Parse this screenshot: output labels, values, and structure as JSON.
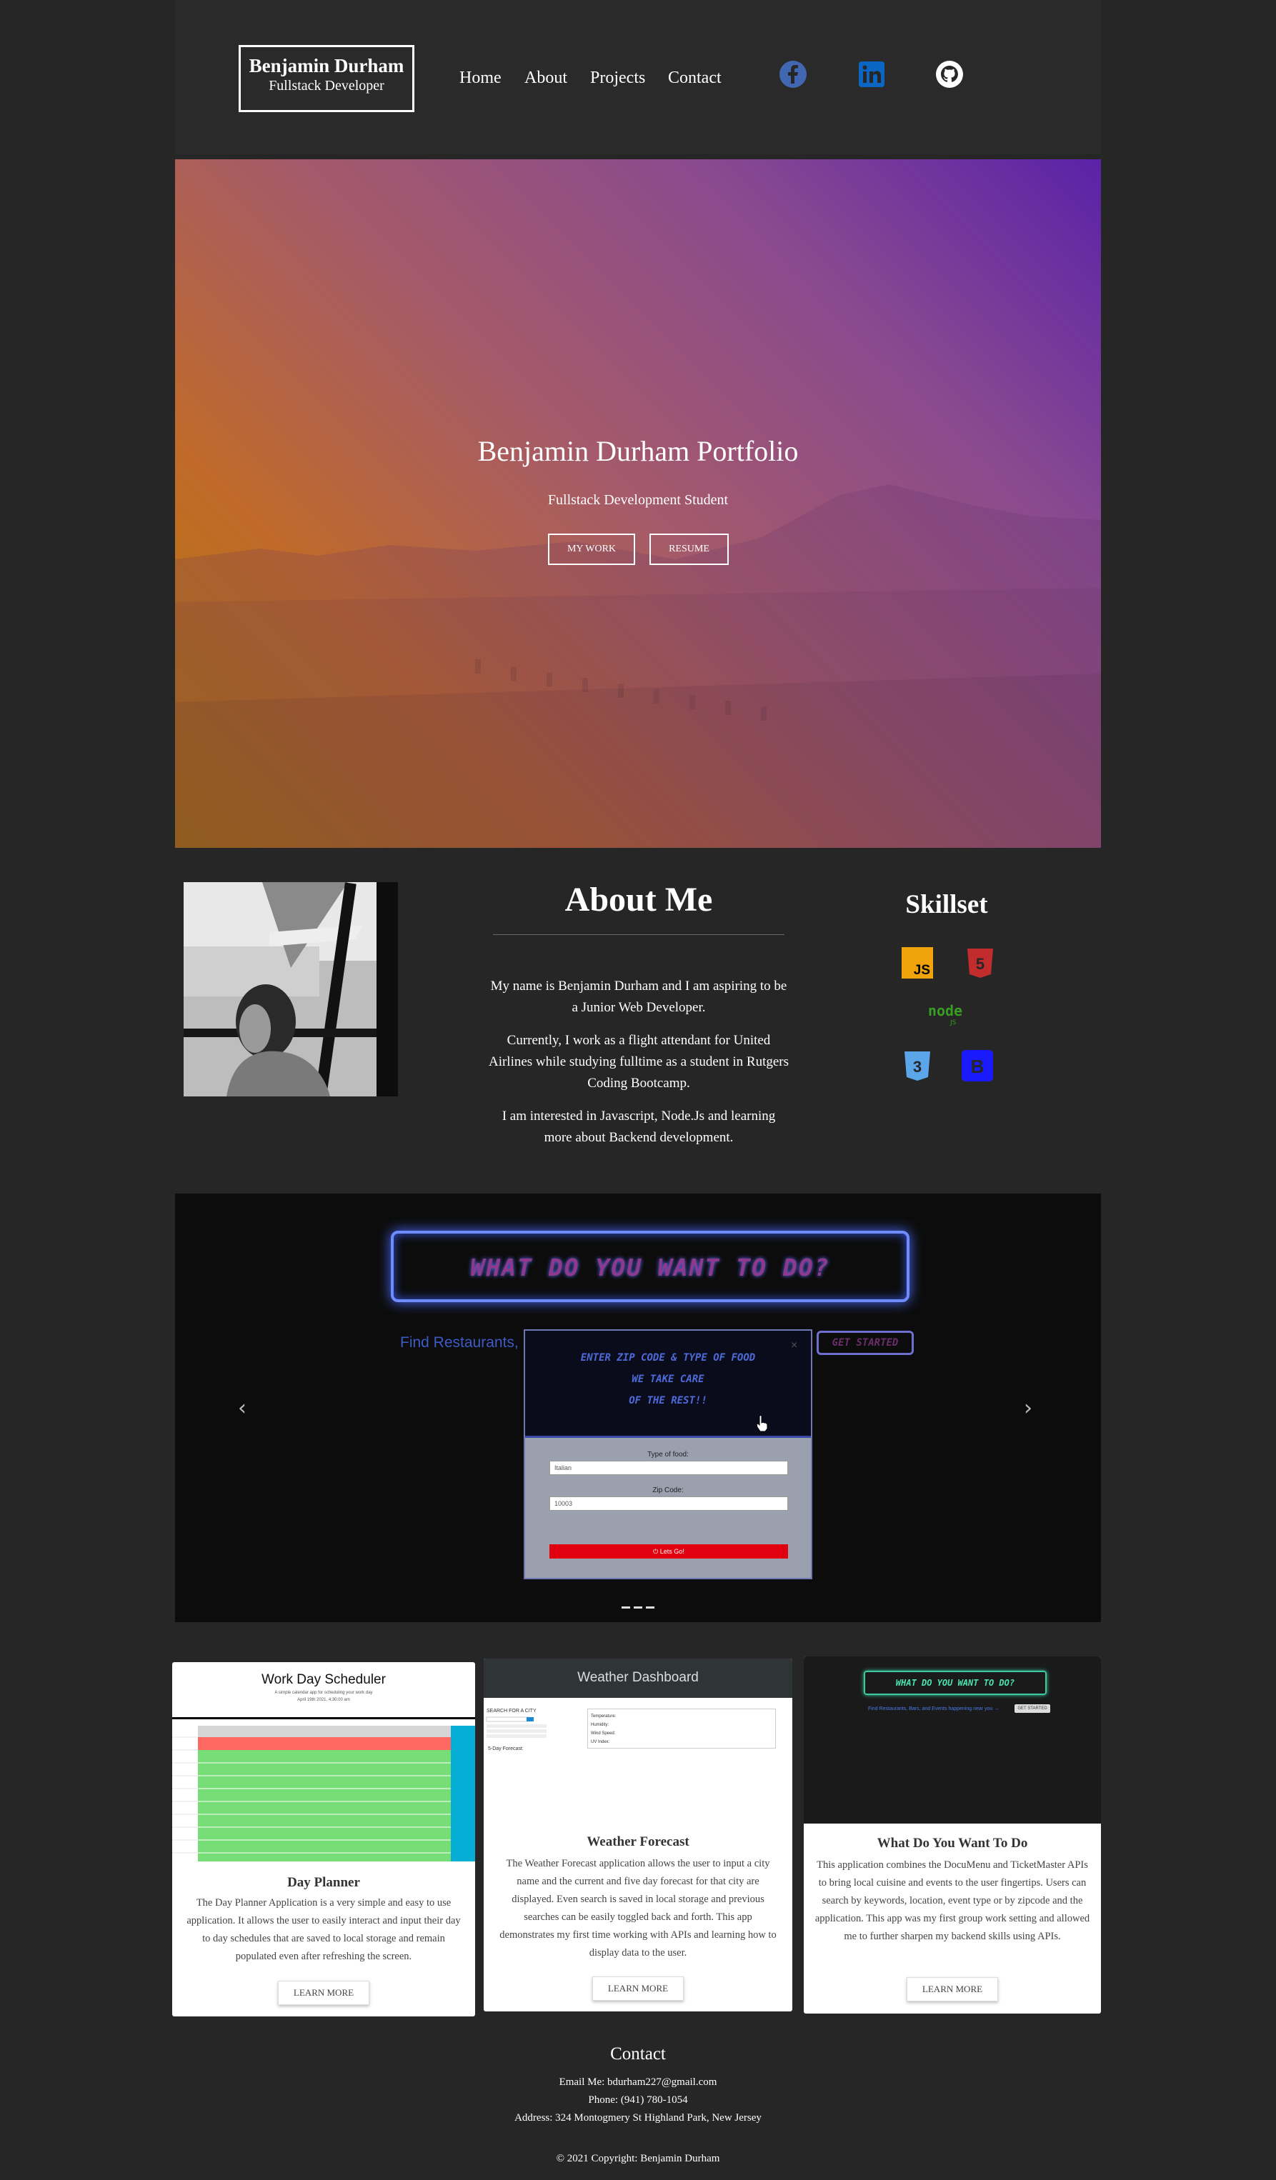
{
  "navbar": {
    "brand_name": "Benjamin Durham",
    "brand_sub": "Fullstack Developer",
    "links": [
      "Home",
      "About",
      "Projects",
      "Contact"
    ],
    "social": [
      "facebook-icon",
      "linkedin-icon",
      "github-icon"
    ],
    "colors": {
      "facebook": "#4267B2",
      "linkedin": "#0A66C2",
      "github": "#ffffff"
    }
  },
  "hero": {
    "title": "Benjamin Durham Portfolio",
    "subtitle": "Fullstack Development Student",
    "btn_work": "MY WORK",
    "btn_resume": "RESUME"
  },
  "about": {
    "title": "About Me",
    "p1": "My name is Benjamin Durham and I am aspiring to be a Junior Web Developer.",
    "p2": "Currently, I work as a flight attendant for United Airlines while studying fulltime as a student in Rutgers Coding Bootcamp.",
    "p3": "I am interested in Javascript, Node.Js and learning more about Backend development."
  },
  "skills": {
    "title": "Skillset",
    "items": [
      "javascript-icon",
      "html5-icon",
      "nodejs-icon",
      "css3-icon",
      "bootstrap-icon"
    ]
  },
  "carousel": {
    "neon_title": "WHAT DO YOU WANT TO DO?",
    "find_text": "Find Restaurants,",
    "get_started": "GET STARTED",
    "modal_lines": [
      "ENTER ZIP CODE & TYPE OF FOOD",
      "WE TAKE CARE",
      "OF THE REST!!"
    ],
    "close": "×",
    "food_label": "Type of food:",
    "food_value": "Italian",
    "zip_label": "Zip Code:",
    "zip_value": "10003",
    "go": "⏻ Lets Go!",
    "prev": "‹",
    "next": "›",
    "slides": 3
  },
  "cards": [
    {
      "thumb_title": "Work Day Scheduler",
      "thumb_sub1": "A simple calendar app for scheduling your work day",
      "thumb_sub2": "April 19th 2021, 4:30:00 am",
      "title": "Day Planner",
      "text": "The Day Planner Application is a very simple and easy to use application. It allows the user to easily interact and input their day to day schedules that are saved to local storage and remain populated even after refreshing the screen.",
      "button": "LEARN MORE"
    },
    {
      "thumb_title": "Weather Dashboard",
      "thumb_search": "SEARCH FOR A CITY",
      "thumb_forecast": "5-Day Forecast:",
      "thumb_stats": [
        "Temperature:",
        "Humidity:",
        "Wind Speed:",
        "UV Index:"
      ],
      "title": "Weather Forecast",
      "text": "The Weather Forecast application allows the user to input a city name and the current and five day forecast for that city are displayed. Even search is saved in local storage and previous searches can be easily toggled back and forth. This app demonstrates my first time working with APIs and learning how to display data to the user.",
      "button": "LEARN MORE"
    },
    {
      "thumb_title": "WHAT DO YOU WANT TO DO?",
      "thumb_find": "Find Restaurants, Bars, and Events happening near you →",
      "thumb_btn": "GET STARTED",
      "title": "What Do You Want To Do",
      "text": "This application combines the DocuMenu and TicketMaster APIs to bring local cuisine and events to the user fingertips. Users can search by keywords, location, event type or by zipcode and the application. This app was my first group work setting and allowed me to further sharpen my backend skills using APIs.",
      "button": "LEARN MORE"
    }
  ],
  "footer": {
    "title": "Contact",
    "email": "Email Me: bdurham227@gmail.com",
    "phone": "Phone: (941) 780-1054",
    "address": "Address: 324 Montogmery St Highland Park, New Jersey",
    "copyright": "© 2021 Copyright: Benjamin Durham"
  }
}
